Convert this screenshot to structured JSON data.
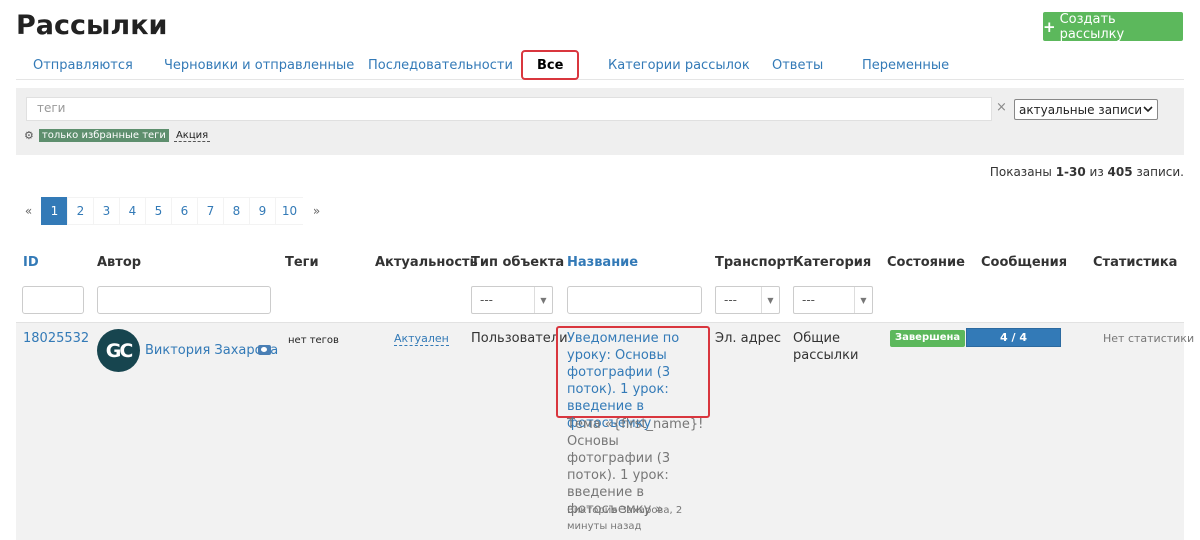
{
  "header": {
    "title": "Рассылки",
    "create_button": "Создать рассылку",
    "create_icon": "+"
  },
  "tabs": [
    {
      "label": "Отправляются",
      "active": false
    },
    {
      "label": "Черновики и отправленные",
      "active": false
    },
    {
      "label": "Последовательности",
      "active": false
    },
    {
      "label": "Все",
      "active": true
    },
    {
      "label": "Категории рассылок",
      "active": false
    },
    {
      "label": "Ответы",
      "active": false
    },
    {
      "label": "Переменные",
      "active": false
    }
  ],
  "filters": {
    "tags_placeholder": "теги",
    "clear_icon": "×",
    "state_select": "актуальные записи",
    "settings_icon": "gear-icon",
    "fav_tags_label": "только избранные теги",
    "tag_chip": "Акция"
  },
  "summary": {
    "prefix": "Показаны ",
    "range": "1-30",
    "mid": " из ",
    "total": "405",
    "suffix": " записи."
  },
  "pagination": {
    "prev": "«",
    "pages": [
      "1",
      "2",
      "3",
      "4",
      "5",
      "6",
      "7",
      "8",
      "9",
      "10"
    ],
    "current": "1",
    "next": "»"
  },
  "table": {
    "columns": [
      "ID",
      "Автор",
      "Теги",
      "Актуальность",
      "Тип объекта",
      "Название",
      "Транспорт",
      "Категория",
      "Состояние",
      "Сообщения",
      "Статистика"
    ],
    "sortable_columns": [
      "ID",
      "Название"
    ],
    "filter_select_value": "---",
    "rows": [
      {
        "id": "18025532",
        "avatar_initials": "GC",
        "author": "Виктория Захарова",
        "tags": "нет тегов",
        "actuality": "Актуален",
        "object_type": "Пользователи",
        "title": "Уведомление по уроку: Основы фотографии (3 поток). 1 урок: введение в фотосъемку",
        "subject": "Тема «{first_name}! Основы фотографии (3 поток). 1 урок: введение в фотосъемку »",
        "meta": "Виктория Захарова, 2 минуты назад",
        "transport": "Эл. адрес",
        "category": "Общие рассылки",
        "state": "Завершена",
        "messages": "4 / 4",
        "messages_progress": 1.0,
        "statistics": "Нет статистики"
      }
    ]
  },
  "colors": {
    "accent": "#337ab7",
    "success": "#5cb85c",
    "highlight": "#d9363e",
    "avatar_bg": "#17454f"
  }
}
